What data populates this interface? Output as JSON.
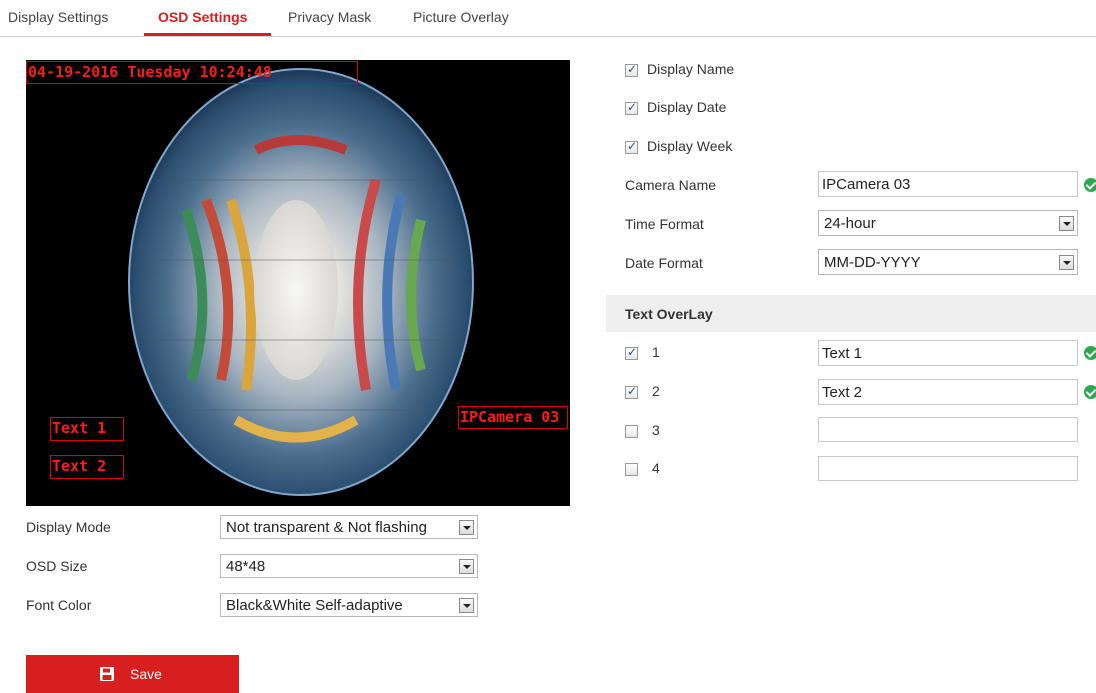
{
  "tabs": [
    "Display Settings",
    "OSD Settings",
    "Privacy Mask",
    "Picture Overlay"
  ],
  "active_tab": "OSD Settings",
  "video": {
    "datetime_overlay": "04-19-2016 Tuesday 10:24:48",
    "camera_name_overlay": "IPCamera 03",
    "text1_overlay": "Text 1",
    "text2_overlay": "Text 2"
  },
  "display_mode": {
    "label": "Display Mode",
    "value": "Not transparent & Not flashing"
  },
  "osd_size": {
    "label": "OSD Size",
    "value": "48*48"
  },
  "font_color": {
    "label": "Font Color",
    "value": "Black&White Self-adaptive"
  },
  "save_button": {
    "label": "Save",
    "icon": "floppy-disk-icon"
  },
  "display_name": {
    "label": "Display Name",
    "checked": true
  },
  "display_date": {
    "label": "Display Date",
    "checked": true
  },
  "display_week": {
    "label": "Display Week",
    "checked": true
  },
  "camera_name": {
    "label": "Camera Name",
    "value": "IPCamera 03",
    "valid": true
  },
  "time_format": {
    "label": "Time Format",
    "value": "24-hour"
  },
  "date_format": {
    "label": "Date Format",
    "value": "MM-DD-YYYY"
  },
  "text_overlay": {
    "title": "Text OverLay",
    "items": [
      {
        "num": "1",
        "checked": true,
        "value": "Text 1",
        "valid": true
      },
      {
        "num": "2",
        "checked": true,
        "value": "Text 2",
        "valid": true
      },
      {
        "num": "3",
        "checked": false,
        "value": ""
      },
      {
        "num": "4",
        "checked": false,
        "value": ""
      }
    ]
  },
  "colors": {
    "accent": "#d71f1f",
    "osd_red": "#ff1a1a",
    "valid_green": "#2ea84a"
  }
}
